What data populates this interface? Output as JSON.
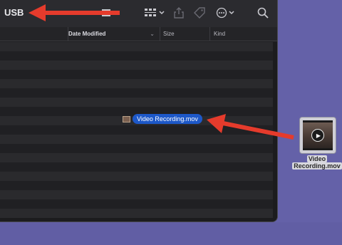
{
  "window": {
    "title": "USB"
  },
  "columns": {
    "date_modified": "Date Modified",
    "size": "Size",
    "kind": "Kind"
  },
  "drag_item": {
    "name": "Video Recording.mov"
  },
  "desktop_file": {
    "name_line1": "Video",
    "name_line2": "Recording.mov"
  },
  "icons": {
    "view": "list-view-icon",
    "group": "group-icon",
    "share": "share-icon",
    "tag": "tag-icon",
    "more": "more-icon",
    "search": "search-icon",
    "play": "play-icon"
  },
  "colors": {
    "desktop": "#6461a8",
    "annotation_arrow": "#e53b2c",
    "selection": "#1d58c8"
  }
}
